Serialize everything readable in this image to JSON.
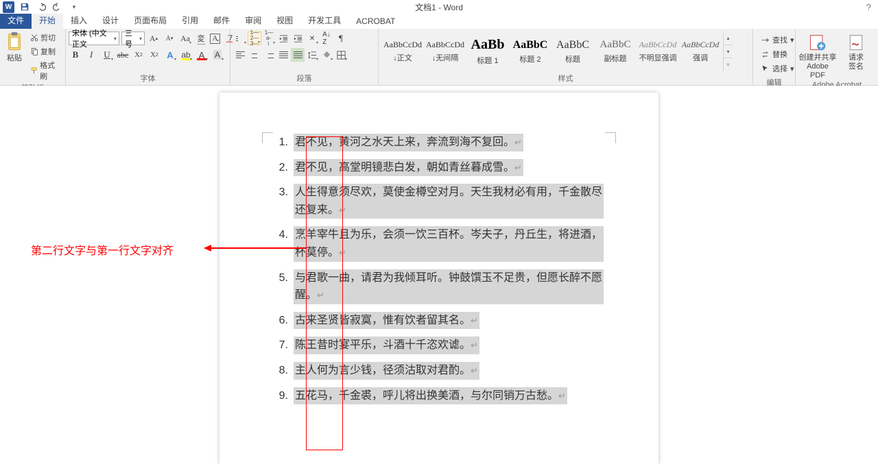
{
  "title": "文档1 - Word",
  "tabs": {
    "file": "文件",
    "home": "开始",
    "insert": "插入",
    "design": "设计",
    "layout": "页面布局",
    "references": "引用",
    "mailings": "邮件",
    "review": "审阅",
    "view": "视图",
    "developer": "开发工具",
    "acrobat": "ACROBAT"
  },
  "clipboard": {
    "label": "剪贴板",
    "paste": "粘贴",
    "cut": "剪切",
    "copy": "复制",
    "painter": "格式刷"
  },
  "font": {
    "label": "字体",
    "name": "宋体 (中文正文",
    "size": "三号"
  },
  "paragraph": {
    "label": "段落"
  },
  "styles_label": "样式",
  "styles": [
    {
      "preview": "AaBbCcDd",
      "name": "↓正文",
      "size": "12px",
      "color": "#333",
      "italic": false
    },
    {
      "preview": "AaBbCcDd",
      "name": "↓无间隔",
      "size": "12px",
      "color": "#333",
      "italic": false
    },
    {
      "preview": "AaBb",
      "name": "标题 1",
      "size": "20px",
      "color": "#000",
      "italic": false,
      "bold": true
    },
    {
      "preview": "AaBbC",
      "name": "标题 2",
      "size": "16px",
      "color": "#000",
      "italic": false,
      "bold": true
    },
    {
      "preview": "AaBbC",
      "name": "标题",
      "size": "16px",
      "color": "#333",
      "italic": false
    },
    {
      "preview": "AaBbC",
      "name": "副标题",
      "size": "15px",
      "color": "#666",
      "italic": false
    },
    {
      "preview": "AaBbCcDd",
      "name": "不明显强调",
      "size": "12px",
      "color": "#888",
      "italic": true
    },
    {
      "preview": "AaBbCcDd",
      "name": "强调",
      "size": "12px",
      "color": "#555",
      "italic": true
    }
  ],
  "editing": {
    "label": "编辑",
    "find": "查找",
    "replace": "替换",
    "select": "选择"
  },
  "adobe": {
    "label": "Adobe Acrobat",
    "createShare": "创建并共享\nAdobe PDF",
    "requestSign": "请求\n签名"
  },
  "annotation": "第二行文字与第一行文字对齐",
  "list": [
    "君不见，黄河之水天上来，奔流到海不复回。",
    "君不见，高堂明镜悲白发，朝如青丝暮成雪。",
    "人生得意须尽欢，莫使金樽空对月。天生我材必有用，千金散尽还复来。",
    "烹羊宰牛且为乐，会须一饮三百杯。岑夫子，丹丘生，将进酒，杯莫停。",
    "与君歌一曲，请君为我倾耳听。钟鼓馔玉不足贵，但愿长醉不愿醒。",
    "古来圣贤皆寂寞，惟有饮者留其名。",
    "陈王昔时宴平乐，斗酒十千恣欢谑。",
    "主人何为言少钱，径须沽取对君酌。",
    "五花马，千金裘，呼儿将出换美酒，与尔同销万古愁。"
  ]
}
